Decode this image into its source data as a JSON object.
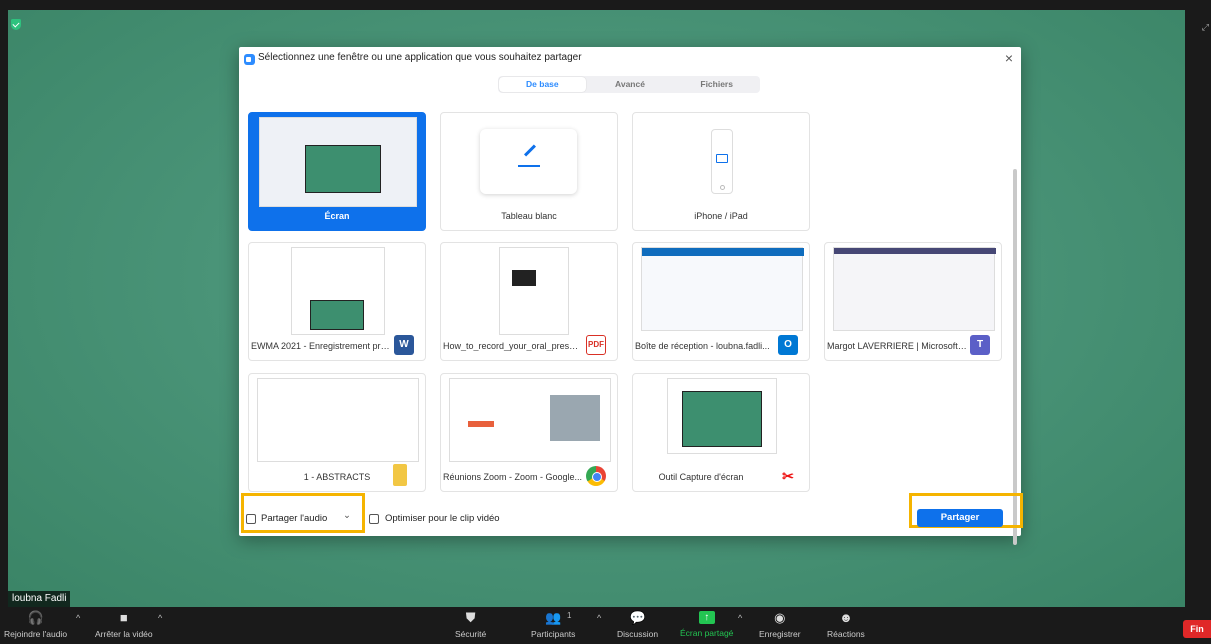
{
  "participant_name": "loubna Fadli",
  "dialog": {
    "title": "Sélectionnez une fenêtre ou une application que vous souhaitez partager",
    "close_icon": "×",
    "tabs": [
      {
        "label": "De base",
        "active": true
      },
      {
        "label": "Avancé",
        "active": false
      },
      {
        "label": "Fichiers",
        "active": false
      }
    ],
    "sources": [
      {
        "label": "Écran",
        "selected": true,
        "icon": "screen-thumbnail"
      },
      {
        "label": "Tableau blanc",
        "icon": "whiteboard-icon"
      },
      {
        "label": "iPhone / iPad",
        "icon": "iphone-icon"
      },
      {
        "label": "EWMA 2021 - Enregistrement pré...",
        "app_icon": "W",
        "icon": "word-icon"
      },
      {
        "label": "How_to_record_your_oral_present...",
        "app_icon": "PDF",
        "icon": "pdf-icon"
      },
      {
        "label": "Boîte de réception - loubna.fadli...",
        "app_icon": "O",
        "icon": "outlook-icon"
      },
      {
        "label": "Margot LAVERRIERE | Microsoft T...",
        "app_icon": "T",
        "icon": "teams-icon"
      },
      {
        "label": "1 - ABSTRACTS",
        "icon": "folder-icon"
      },
      {
        "label": "Réunions Zoom - Zoom - Google...",
        "icon": "chrome-icon"
      },
      {
        "label": "Outil Capture d'écran",
        "icon": "snipping-tool-icon"
      }
    ],
    "footer": {
      "share_audio_label": "Partager l'audio",
      "share_audio_caret": "⌄",
      "optimize_video_label": "Optimiser pour le clip vidéo",
      "share_button_label": "Partager"
    }
  },
  "toolbar": {
    "join_audio": "Rejoindre l'audio",
    "stop_video": "Arrêter la vidéo",
    "security": "Sécurité",
    "participants": "Participants",
    "participants_count": "1",
    "chat": "Discussion",
    "share_screen": "Écran partagé",
    "record": "Enregistrer",
    "reactions": "Réactions",
    "end": "Fin"
  },
  "colors": {
    "accent": "#0e71eb",
    "highlight": "#f5b400",
    "end_button": "#e02828",
    "share_active": "#23c552"
  }
}
